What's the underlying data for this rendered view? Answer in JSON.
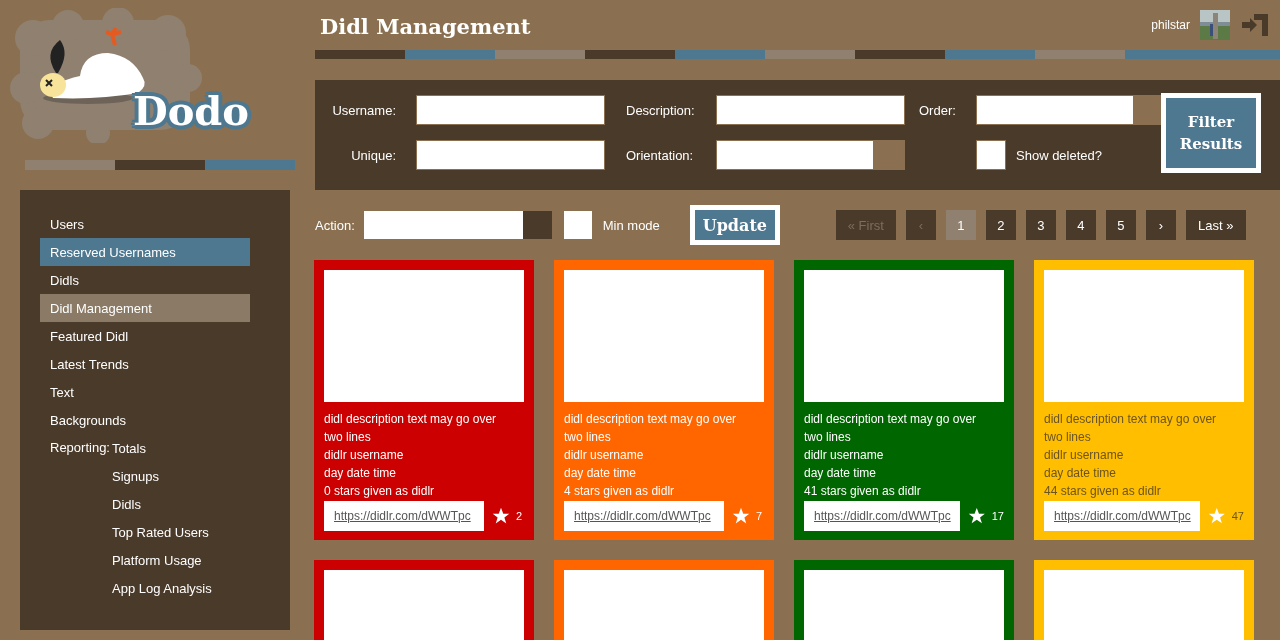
{
  "logo": {
    "text": "Dodo"
  },
  "sidebar": {
    "items": [
      {
        "label": "Users",
        "hovered": false,
        "selected": false
      },
      {
        "label": "Reserved Usernames",
        "hovered": true,
        "selected": false
      },
      {
        "label": "Didls",
        "hovered": false,
        "selected": false
      },
      {
        "label": "Didl Management",
        "hovered": false,
        "selected": true
      },
      {
        "label": "Featured Didl",
        "hovered": false,
        "selected": false
      },
      {
        "label": "Latest Trends",
        "hovered": false,
        "selected": false
      },
      {
        "label": "Text",
        "hovered": false,
        "selected": false
      },
      {
        "label": "Backgrounds",
        "hovered": false,
        "selected": false
      },
      {
        "label": "Reporting:",
        "children": [
          {
            "label": "Totals",
            "hovered": false,
            "selected": false
          },
          {
            "label": "Signups",
            "hovered": false,
            "selected": false
          },
          {
            "label": "Didls",
            "hovered": false,
            "selected": false
          },
          {
            "label": "Top Rated Users",
            "hovered": false,
            "selected": false
          },
          {
            "label": "Platform Usage",
            "hovered": false,
            "selected": false
          },
          {
            "label": "App Log Analysis",
            "hovered": false,
            "selected": false
          }
        ]
      }
    ]
  },
  "header": {
    "title": "Didl Management",
    "user": {
      "name": "philstar"
    }
  },
  "filters": {
    "fields": [
      {
        "label": "Username:",
        "kind": "text"
      },
      {
        "label": "Description:",
        "kind": "text"
      },
      {
        "label": "Order:",
        "kind": "select"
      },
      {
        "label": "Unique:",
        "kind": "text"
      },
      {
        "label": "Orientation:",
        "kind": "select"
      },
      {
        "label": "Show deleted?",
        "kind": "checkbox",
        "checked": false
      }
    ],
    "button": "Filter Results"
  },
  "actions": {
    "action_label": "Action:",
    "min_mode": {
      "label": "Min mode",
      "checked": false
    },
    "button": "Update"
  },
  "pagination": [
    {
      "label": "« First",
      "disabled": true,
      "selected": false
    },
    {
      "label": "‹",
      "disabled": true,
      "selected": false
    },
    {
      "label": "1",
      "disabled": false,
      "selected": true
    },
    {
      "label": "2",
      "disabled": false,
      "selected": false
    },
    {
      "label": "3",
      "disabled": false,
      "selected": false
    },
    {
      "label": "4",
      "disabled": false,
      "selected": false
    },
    {
      "label": "5",
      "disabled": false,
      "selected": false
    },
    {
      "label": "›",
      "disabled": false,
      "selected": false
    },
    {
      "label": "Last »",
      "disabled": false,
      "selected": false
    }
  ],
  "cards": [
    {
      "color": "#cc0000",
      "description": "didl description text may go over two lines",
      "username": "didlr username",
      "datetime": "day date time",
      "stars_given": "0 stars given as didlr",
      "link": "https://didlr.com/dWWTpc",
      "star_count": "2"
    },
    {
      "color": "#ff6600",
      "description": "didl description text may go over two lines",
      "username": "didlr username",
      "datetime": "day date time",
      "stars_given": "4 stars given as didlr",
      "link": "https://didlr.com/dWWTpc",
      "star_count": "7"
    },
    {
      "color": "#006600",
      "description": "didl description text may go over two lines",
      "username": "didlr username",
      "datetime": "day date time",
      "stars_given": "41 stars given as didlr",
      "link": "https://didlr.com/dWWTpc",
      "star_count": "17"
    },
    {
      "color": "#ffbf00",
      "description": "didl description text may go over two lines",
      "username": "didlr username",
      "datetime": "day date time",
      "stars_given": "44 stars given as didlr",
      "link": "https://didlr.com/dWWTpc",
      "star_count": "47"
    },
    {
      "color": "#cc0000"
    },
    {
      "color": "#ff6600"
    },
    {
      "color": "#006600"
    },
    {
      "color": "#ffbf00"
    }
  ]
}
